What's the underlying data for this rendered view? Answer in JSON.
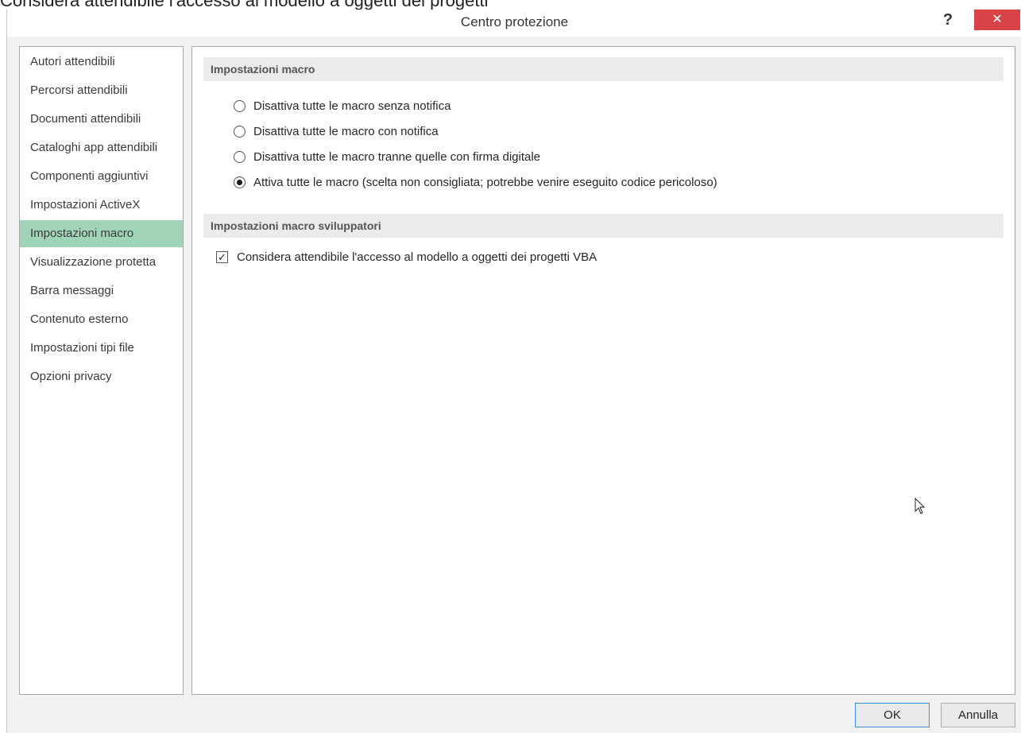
{
  "background_fragment": "Considera attendibile l'accesso al modello a oggetti dei progetti",
  "dialog": {
    "title": "Centro protezione",
    "help_label": "?",
    "close_label": "✕"
  },
  "sidebar": {
    "items": [
      {
        "label": "Autori attendibili",
        "active": false
      },
      {
        "label": "Percorsi attendibili",
        "active": false
      },
      {
        "label": "Documenti attendibili",
        "active": false
      },
      {
        "label": "Cataloghi app attendibili",
        "active": false
      },
      {
        "label": "Componenti aggiuntivi",
        "active": false
      },
      {
        "label": "Impostazioni ActiveX",
        "active": false
      },
      {
        "label": "Impostazioni macro",
        "active": true
      },
      {
        "label": "Visualizzazione protetta",
        "active": false
      },
      {
        "label": "Barra messaggi",
        "active": false
      },
      {
        "label": "Contenuto esterno",
        "active": false
      },
      {
        "label": "Impostazioni tipi file",
        "active": false
      },
      {
        "label": "Opzioni privacy",
        "active": false
      }
    ],
    "active_color": "#9fd5b6"
  },
  "macro_settings": {
    "header": "Impostazioni macro",
    "options": [
      {
        "label": "Disattiva tutte le macro senza notifica",
        "checked": false
      },
      {
        "label": "Disattiva tutte le macro con notifica",
        "checked": false
      },
      {
        "label": "Disattiva tutte le macro tranne quelle con firma digitale",
        "checked": false
      },
      {
        "label": "Attiva tutte le macro (scelta non consigliata; potrebbe venire eseguito codice pericoloso)",
        "checked": true
      }
    ]
  },
  "developer_settings": {
    "header": "Impostazioni macro sviluppatori",
    "vba_checkbox": {
      "label": "Considera attendibile l'accesso al modello a oggetti dei progetti VBA",
      "checked": true
    }
  },
  "footer": {
    "ok_label": "OK",
    "cancel_label": "Annulla"
  }
}
